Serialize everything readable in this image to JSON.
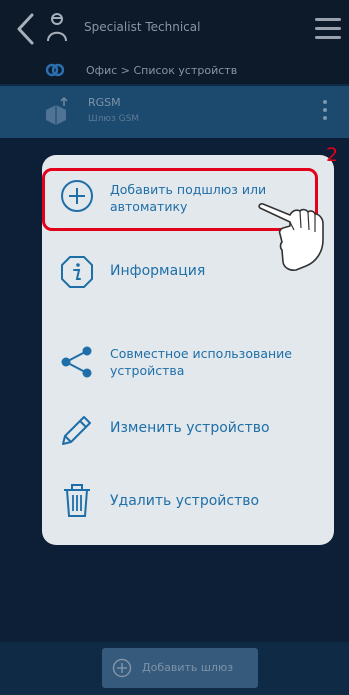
{
  "header": {
    "title": "Specialist Technical",
    "breadcrumb": "Офис > Список устройств"
  },
  "device": {
    "name": "RGSM",
    "subtitle": "Шлюз GSM"
  },
  "menu": {
    "items": [
      {
        "label": "Добавить подшлюз или автоматику",
        "icon": "plus-circle-icon"
      },
      {
        "label": "Информация",
        "icon": "info-icon"
      },
      {
        "label": "Совместное использование устройства",
        "icon": "share-icon"
      },
      {
        "label": "Изменить устройство",
        "icon": "pencil-icon"
      },
      {
        "label": "Удалить устройство",
        "icon": "trash-icon"
      }
    ]
  },
  "annotation": {
    "step": "2",
    "color": "#e3001b"
  },
  "bottom": {
    "add_gateway_label": "Добавить шлюз"
  },
  "colors": {
    "accent": "#1e6fa8",
    "popup_bg": "#e3e8ec",
    "header_bg": "#0c1a2a"
  }
}
